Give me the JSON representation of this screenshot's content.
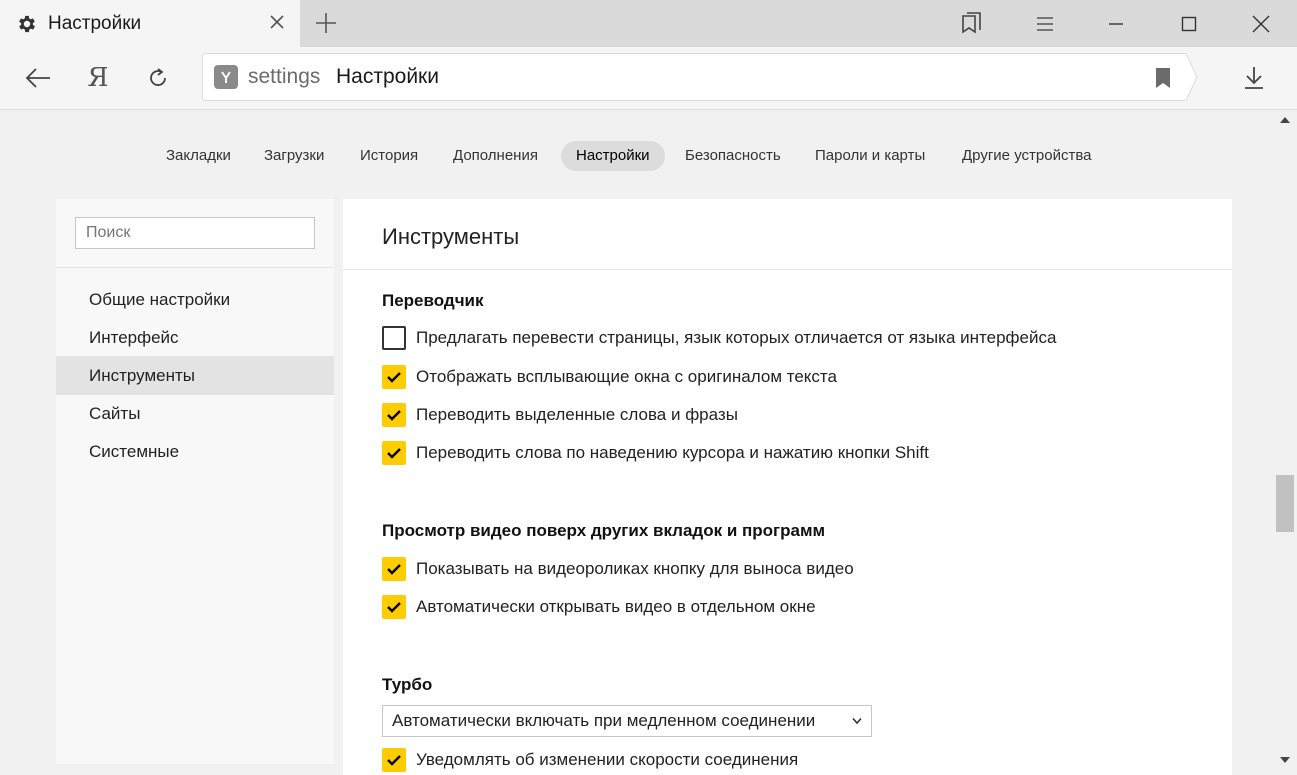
{
  "tab": {
    "title": "Настройки",
    "icon": "gear-icon"
  },
  "address": {
    "host": "settings",
    "title": "Настройки"
  },
  "toolbar": {
    "ya_label": "Я"
  },
  "nav": [
    "Закладки",
    "Загрузки",
    "История",
    "Дополнения",
    "Настройки",
    "Безопасность",
    "Пароли и карты",
    "Другие устройства"
  ],
  "nav_active": "Настройки",
  "sidebar": {
    "search_placeholder": "Поиск",
    "items": [
      "Общие настройки",
      "Интерфейс",
      "Инструменты",
      "Сайты",
      "Системные"
    ],
    "active": "Инструменты"
  },
  "panel": {
    "title": "Инструменты",
    "sections": [
      {
        "title": "Переводчик",
        "options": [
          {
            "label": "Предлагать перевести страницы, язык которых отличается от языка интерфейса",
            "checked": false
          },
          {
            "label": "Отображать всплывающие окна с оригиналом текста",
            "checked": true
          },
          {
            "label": "Переводить выделенные слова и фразы",
            "checked": true
          },
          {
            "label": "Переводить слова по наведению курсора и нажатию кнопки Shift",
            "checked": true
          }
        ]
      },
      {
        "title": "Просмотр видео поверх других вкладок и программ",
        "options": [
          {
            "label": "Показывать на видеороликах кнопку для выноса видео",
            "checked": true
          },
          {
            "label": "Автоматически открывать видео в отдельном окне",
            "checked": true
          }
        ]
      },
      {
        "title": "Турбо",
        "select_value": "Автоматически включать при медленном соединении",
        "options": [
          {
            "label": "Уведомлять об изменении скорости соединения",
            "checked": true
          }
        ]
      }
    ]
  },
  "colors": {
    "checkbox_on": "#ffcc00",
    "active_bg": "#e3e3e3"
  }
}
